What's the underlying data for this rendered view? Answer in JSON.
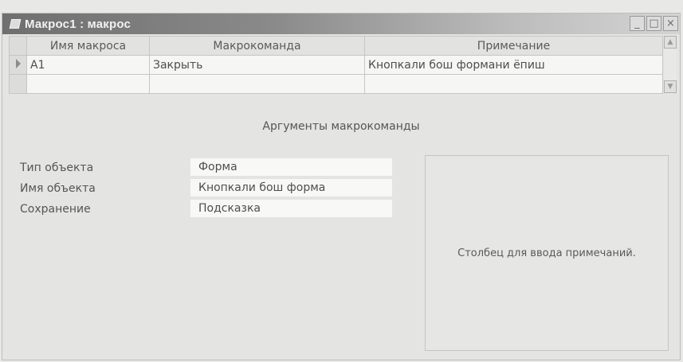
{
  "window": {
    "title": "Макрос1 : макрос",
    "minimize": "_",
    "maximize": "□",
    "close": "×"
  },
  "grid": {
    "columns": [
      "Имя макроса",
      "Макрокоманда",
      "Примечание"
    ],
    "rows": [
      {
        "name": "A1",
        "action": "Закрыть",
        "comment": "Кнопкали бош формани ёпиш"
      },
      {
        "name": "",
        "action": "",
        "comment": ""
      }
    ],
    "scroll_up": "▲",
    "scroll_down": "▼"
  },
  "arguments": {
    "header": "Аргументы макрокоманды",
    "fields": [
      {
        "label": "Тип объекта",
        "value": "Форма"
      },
      {
        "label": "Имя объекта",
        "value": "Кнопкали бош форма"
      },
      {
        "label": "Сохранение",
        "value": "Подсказка"
      }
    ],
    "hint": "Столбец для ввода примечаний."
  }
}
